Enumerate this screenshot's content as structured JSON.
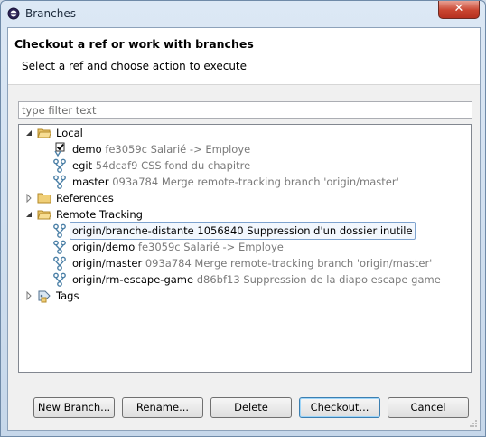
{
  "window": {
    "title": "Branches",
    "close_label": "✕"
  },
  "header": {
    "title": "Checkout a ref or work with branches",
    "subtitle": "Select a ref and choose action to execute"
  },
  "filter": {
    "placeholder": "type filter text",
    "value": ""
  },
  "tree": {
    "local": {
      "label": "Local",
      "branches": [
        {
          "name": "demo",
          "meta": "fe3059c Salarié -> Employe",
          "checked_out": true
        },
        {
          "name": "egit",
          "meta": "54dcaf9 CSS fond du chapitre"
        },
        {
          "name": "master",
          "meta": "093a784 Merge remote-tracking branch 'origin/master'"
        }
      ]
    },
    "references": {
      "label": "References"
    },
    "remote": {
      "label": "Remote Tracking",
      "branches": [
        {
          "name": "origin/branche-distante",
          "meta": "1056840 Suppression d'un dossier inutile",
          "selected": true
        },
        {
          "name": "origin/demo",
          "meta": "fe3059c Salarié -> Employe"
        },
        {
          "name": "origin/master",
          "meta": "093a784 Merge remote-tracking branch 'origin/master'"
        },
        {
          "name": "origin/rm-escape-game",
          "meta": "d86bf13 Suppression de la diapo escape game"
        }
      ]
    },
    "tags": {
      "label": "Tags"
    }
  },
  "buttons": {
    "new_branch": "New Branch...",
    "rename": "Rename...",
    "delete": "Delete",
    "checkout": "Checkout...",
    "cancel": "Cancel"
  },
  "colors": {
    "selection_border": "#7da2ce",
    "meta_text": "#7a7a7a",
    "close": "#c9442f"
  }
}
